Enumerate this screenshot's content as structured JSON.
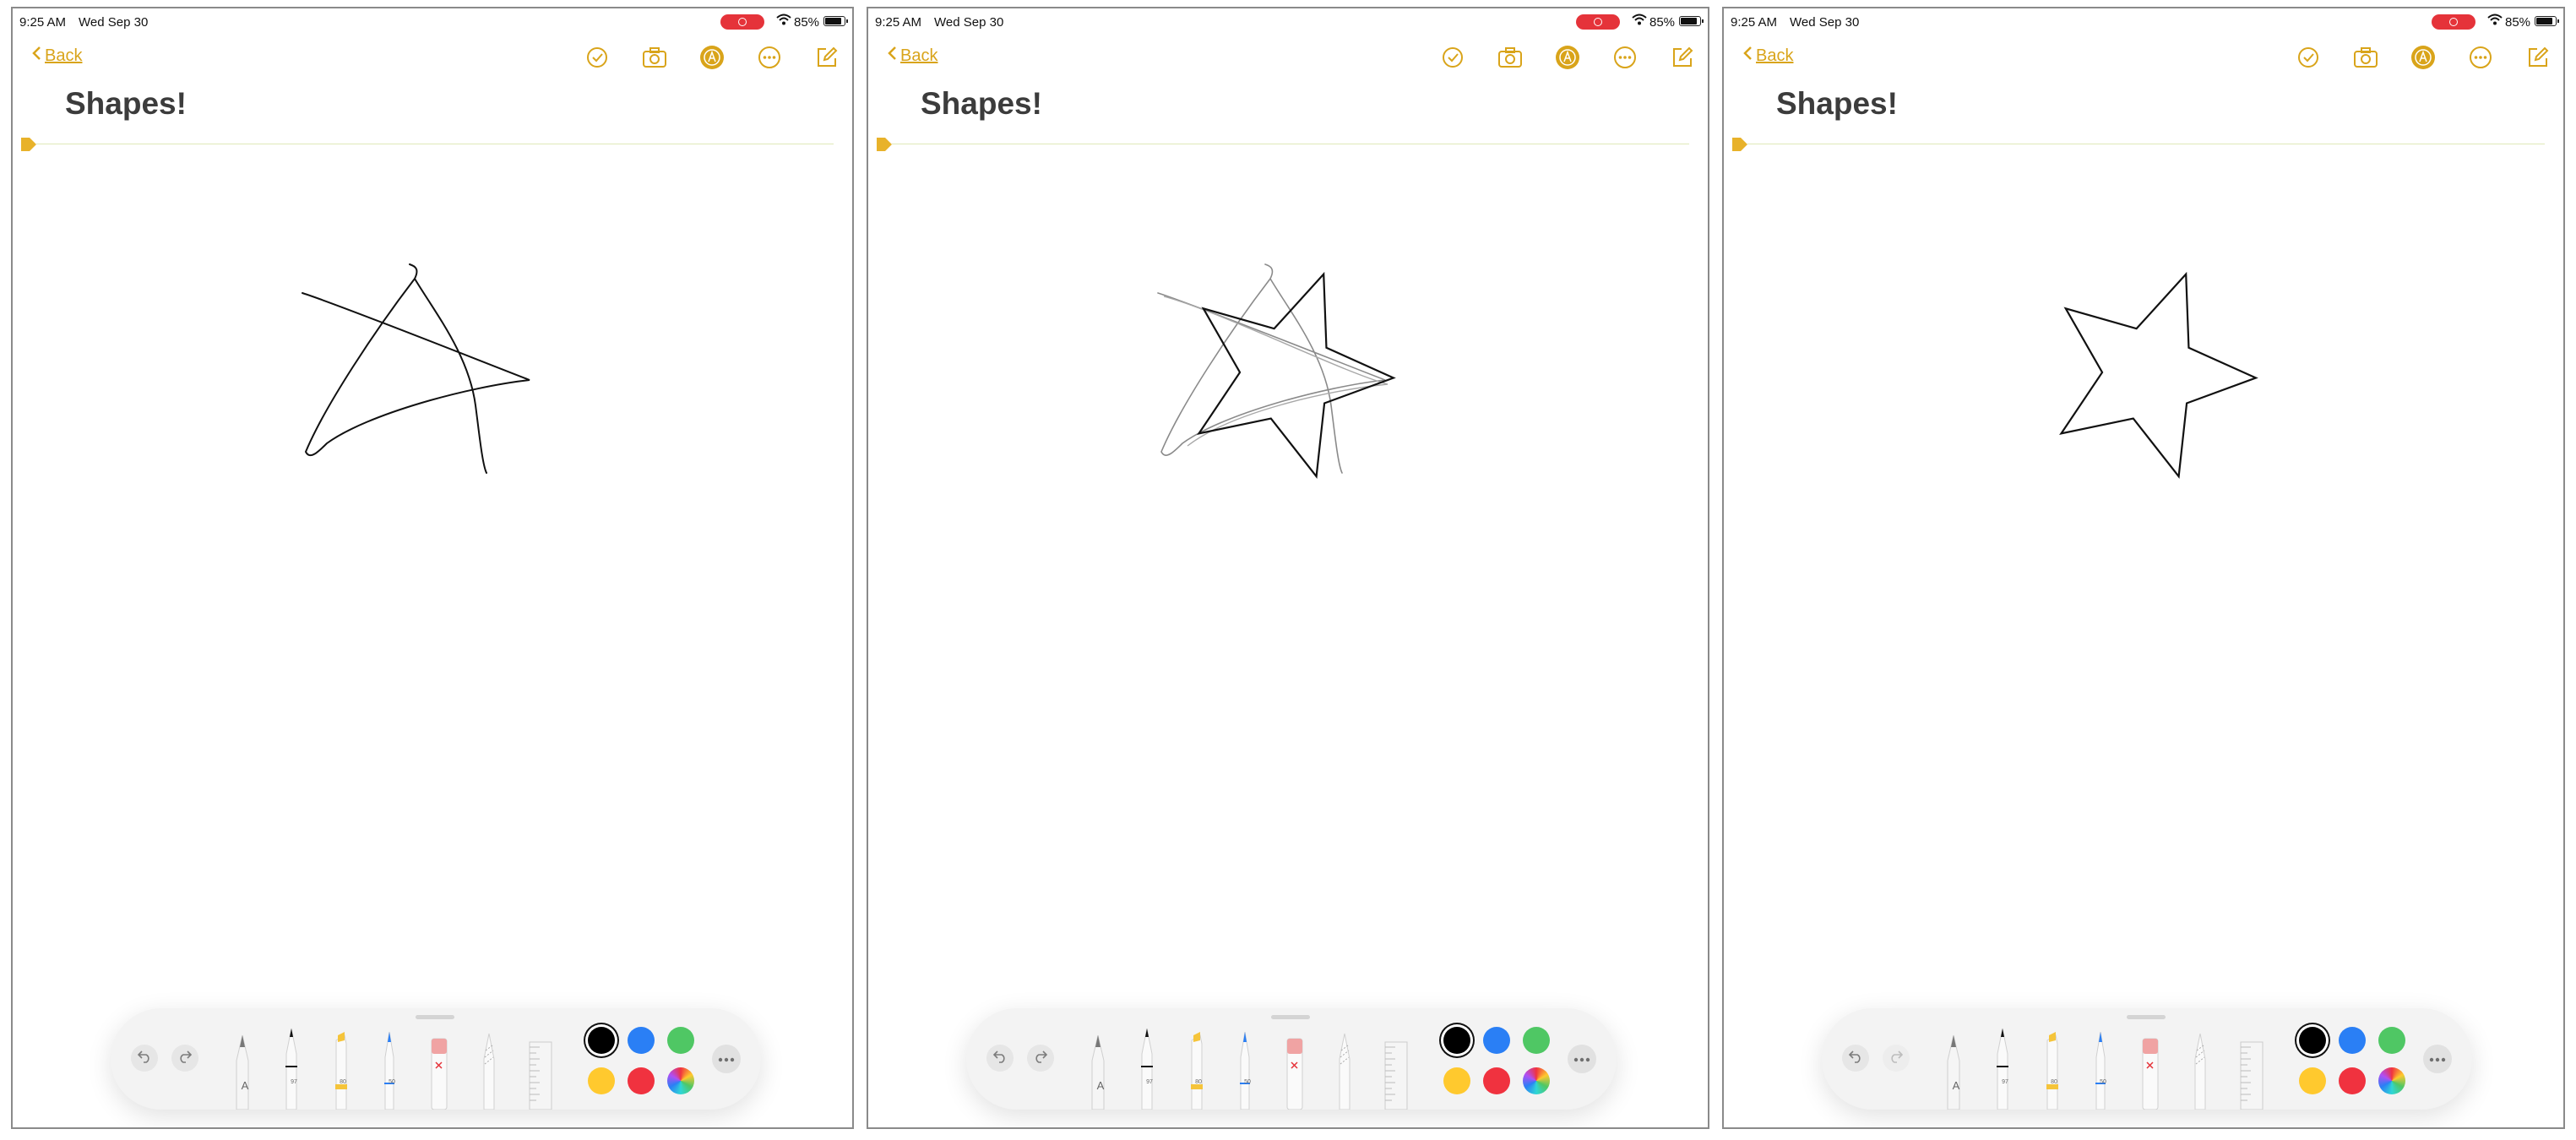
{
  "panels": [
    {
      "id": "freehand-star",
      "redo_enabled": true
    },
    {
      "id": "overlay-star",
      "redo_enabled": true
    },
    {
      "id": "clean-star",
      "redo_enabled": false
    }
  ],
  "status_bar": {
    "time": "9:25 AM",
    "date": "Wed Sep 30",
    "battery": "85%",
    "recording": true
  },
  "nav": {
    "back_label": "Back",
    "icons": [
      "checklist-icon",
      "camera-icon",
      "markup-icon",
      "more-icon",
      "compose-icon"
    ]
  },
  "note": {
    "title": "Shapes!"
  },
  "tools": {
    "items": [
      {
        "name": "pen-tool",
        "label": "A"
      },
      {
        "name": "marker-tool",
        "label": "97"
      },
      {
        "name": "highlighter-tool",
        "label": "80"
      },
      {
        "name": "pencil-tool",
        "label": "50"
      },
      {
        "name": "eraser-tool",
        "label": ""
      },
      {
        "name": "lasso-tool",
        "label": ""
      },
      {
        "name": "ruler-tool",
        "label": ""
      }
    ],
    "colors": [
      "#000000",
      "#2a7ff5",
      "#4fc764",
      "#ffc92e",
      "#f0323f",
      "spectrum"
    ],
    "selected_color": "#000000",
    "accent": "#d9a41a"
  }
}
